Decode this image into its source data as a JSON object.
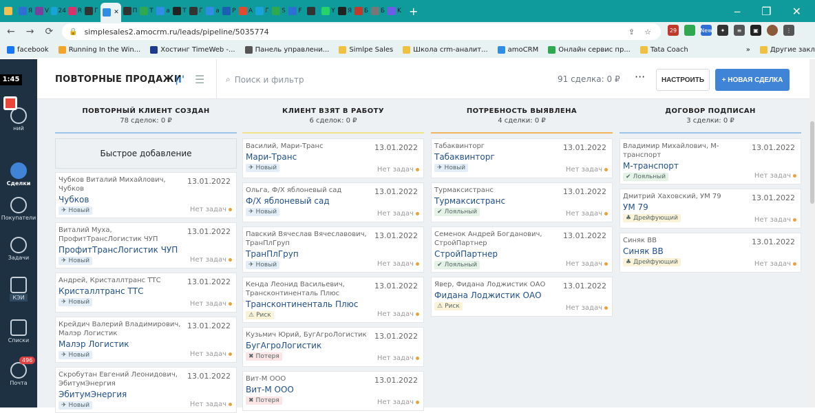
{
  "browser": {
    "tabs": [
      {
        "label": "",
        "icon": "gmail-icon",
        "color": "#f2c14e"
      },
      {
        "label": "Я",
        "icon": "yandex-icon",
        "color": "#2e6fd6"
      },
      {
        "label": "V",
        "icon": "tab-icon",
        "color": "#7b3fa0"
      },
      {
        "label": "24",
        "icon": "bitrix-icon",
        "color": "#1aa3d9"
      },
      {
        "label": "R",
        "icon": "tab-icon",
        "color": "#d6336c"
      },
      {
        "label": "Г",
        "icon": "tab-icon",
        "color": "#333"
      },
      {
        "label": "",
        "icon": "amocrm-icon",
        "color": "#2f8de4",
        "active": true
      },
      {
        "label": "П",
        "icon": "tab-icon",
        "color": "#333"
      },
      {
        "label": "Т",
        "icon": "tab-icon",
        "color": "#2fa84f"
      },
      {
        "label": "a",
        "icon": "amocrm-icon",
        "color": "#2f8de4"
      },
      {
        "label": "T",
        "icon": "tab-icon",
        "color": "#222"
      },
      {
        "label": "Г",
        "icon": "tab-icon",
        "color": "#333"
      },
      {
        "label": "a",
        "icon": "amocrm-icon",
        "color": "#2f8de4"
      },
      {
        "label": "Р",
        "icon": "tab-icon",
        "color": "#1a5fb4"
      },
      {
        "label": "A",
        "icon": "tab-icon",
        "color": "#e04a2f"
      },
      {
        "label": "Г",
        "icon": "tab-icon",
        "color": "#1aa3d9"
      },
      {
        "label": "S",
        "icon": "tab-icon",
        "color": "#2fa84f"
      },
      {
        "label": "F",
        "icon": "tab-icon",
        "color": "#2e6fd6"
      },
      {
        "label": "",
        "icon": "tab-icon",
        "color": "#333"
      },
      {
        "label": "Y",
        "icon": "whatsapp-icon",
        "color": "#25d366"
      },
      {
        "label": "Я",
        "icon": "yandex-icon",
        "color": "#222"
      },
      {
        "label": "Б",
        "icon": "tab-icon",
        "color": "#c0392b"
      },
      {
        "label": "Б",
        "icon": "tab-icon",
        "color": "#777"
      },
      {
        "label": "K",
        "icon": "tab-icon",
        "color": "#6c5ce7"
      }
    ],
    "new_tab": "+",
    "win_min": "‒",
    "win_max": "❐",
    "win_close": "✕",
    "url": "simplesales2.amocrm.ru/leads/pipeline/5035774",
    "back": "←",
    "forward": "→",
    "reload": "⟳",
    "ext_badges": [
      "29",
      "New"
    ],
    "bookmarks": [
      {
        "label": "facebook",
        "color": "#1877f2"
      },
      {
        "label": "Running In the Win...",
        "color": "#f1a52a"
      },
      {
        "label": "Хостинг TimeWeb -...",
        "color": "#1e3a8a"
      },
      {
        "label": "Панель управлени...",
        "color": "#555"
      },
      {
        "label": "Simlpe Sales",
        "color": "#f0c040"
      },
      {
        "label": "Школа crm-аналит...",
        "color": "#f0c040"
      },
      {
        "label": "amoCRM",
        "color": "#2f8de4"
      },
      {
        "label": "Онлайн сервис пр...",
        "color": "#2fa84f"
      },
      {
        "label": "Tata Coach",
        "color": "#f0c040"
      }
    ],
    "bookmarks_more": "»",
    "other_bookmarks": "Другие закладки"
  },
  "sidebar": {
    "timer": "1:45",
    "items": [
      {
        "label": "Сделки",
        "icon": "deals-icon"
      },
      {
        "label": "Покупатели",
        "icon": "customers-icon"
      },
      {
        "label": "Задачи",
        "icon": "tasks-icon"
      },
      {
        "label": "КЭИ",
        "icon": "kei-icon"
      },
      {
        "label": "Списки",
        "icon": "lists-icon"
      },
      {
        "label": "Почта",
        "icon": "mail-icon"
      }
    ],
    "mail_badge": "496",
    "partial_label": "ний"
  },
  "header": {
    "title": "ПОВТОРНЫЕ ПРОДАЖИ",
    "search_placeholder": "Поиск и фильтр",
    "deal_count": "91 сделка: 0 ₽",
    "more": "···",
    "setup": "НАСТРОИТЬ",
    "new_deal": "+ НОВАЯ СДЕЛКА"
  },
  "quick_add": "Быстрое добавление",
  "no_tasks": "Нет задач",
  "columns": [
    {
      "title": "ПОВТОРНЫЙ КЛИЕНТ СОЗДАН",
      "sub": "78 сделок: 0 ₽",
      "color": "#9cc4ea",
      "cards": [
        {
          "contact": "Чубков Виталий Михайлович, Чубков",
          "date": "13.01.2022",
          "name": "Чубков",
          "tag": "Новый",
          "tagtype": "new"
        },
        {
          "contact": "Виталий Муха, ПрофитТрансЛогистик ЧУП",
          "date": "13.01.2022",
          "name": "ПрофитТрансЛогистик ЧУП",
          "tag": "Новый",
          "tagtype": "new"
        },
        {
          "contact": "Андрей, Кристаллтранс ТТС",
          "date": "13.01.2022",
          "name": "Кристаллтранс ТТС",
          "tag": "Новый",
          "tagtype": "new"
        },
        {
          "contact": "Крейдич Валерий Владимирович, Малэр Логистик",
          "date": "13.01.2022",
          "name": "Малэр Логистик",
          "tag": "Новый",
          "tagtype": "new"
        },
        {
          "contact": "Скробутан Евгений Леонидович, ЭбитумЭнергия",
          "date": "13.01.2022",
          "name": "ЭбитумЭнергия",
          "tag": "Новый",
          "tagtype": "new"
        }
      ]
    },
    {
      "title": "КЛИЕНТ ВЗЯТ В РАБОТУ",
      "sub": "6 сделок: 0 ₽",
      "color": "#f2e38a",
      "cards": [
        {
          "contact": "Василий, Мари-Транс",
          "date": "13.01.2022",
          "name": "Мари-Транс",
          "tag": "Новый",
          "tagtype": "new"
        },
        {
          "contact": "Ольга, Ф/Х яблоневый сад",
          "date": "13.01.2022",
          "name": "Ф/Х яблоневый сад",
          "tag": "Новый",
          "tagtype": "new"
        },
        {
          "contact": "Павский Вячеслав Вячеславович, ТранПлГруп",
          "date": "13.01.2022",
          "name": "ТранПлГруп",
          "tag": "Новый",
          "tagtype": "new"
        },
        {
          "contact": "Кенда Леонид Васильевич, Трансконтиненталь Плюс",
          "date": "13.01.2022",
          "name": "Трансконтиненталь Плюс",
          "tag": "Риск",
          "tagtype": "risk"
        },
        {
          "contact": "Кузьмич Юрий, БугАгроЛогистик",
          "date": "13.01.2022",
          "name": "БугАгроЛогистик",
          "tag": "Потеря",
          "tagtype": "lost"
        },
        {
          "contact": "Вит-М ООО",
          "date": "13.01.2022",
          "name": "Вит-М ООО",
          "tag": "Потеря",
          "tagtype": "lost"
        }
      ]
    },
    {
      "title": "ПОТРЕБНОСТЬ ВЫЯВЛЕНА",
      "sub": "4 сделки: 0 ₽",
      "color": "#f2b45a",
      "cards": [
        {
          "contact": "Табаквинторг",
          "date": "13.01.2022",
          "name": "Табаквинторг",
          "tag": "Новый",
          "tagtype": "new"
        },
        {
          "contact": "Турмаксистранс",
          "date": "13.01.2022",
          "name": "Турмаксистранс",
          "tag": "Лояльный",
          "tagtype": "loyal"
        },
        {
          "contact": "Семенок Андрей Богданович, СтройПартнер",
          "date": "13.01.2022",
          "name": "СтройПартнер",
          "tag": "Лояльный",
          "tagtype": "loyal"
        },
        {
          "contact": "Явер, Фидана Лоджистик ОАО",
          "date": "13.01.2022",
          "name": "Фидана Лоджистик ОАО",
          "tag": "Риск",
          "tagtype": "risk"
        }
      ]
    },
    {
      "title": "ДОГОВОР ПОДПИСАН",
      "sub": "3 сделки: 0 ₽",
      "color": "#9cc4ea",
      "cards": [
        {
          "contact": "Владимир Михайлович, М-транспорт",
          "date": "13.01.2022",
          "name": "М-транспорт",
          "tag": "Лояльный",
          "tagtype": "loyal"
        },
        {
          "contact": "Дмитрий Хаховский, УМ 79",
          "date": "13.01.2022",
          "name": "УМ 79",
          "tag": "Дрейфующий",
          "tagtype": "drift"
        },
        {
          "contact": "Синяк ВВ",
          "date": "13.01.2022",
          "name": "Синяк ВВ",
          "tag": "Дрейфующий",
          "tagtype": "drift"
        }
      ]
    }
  ]
}
